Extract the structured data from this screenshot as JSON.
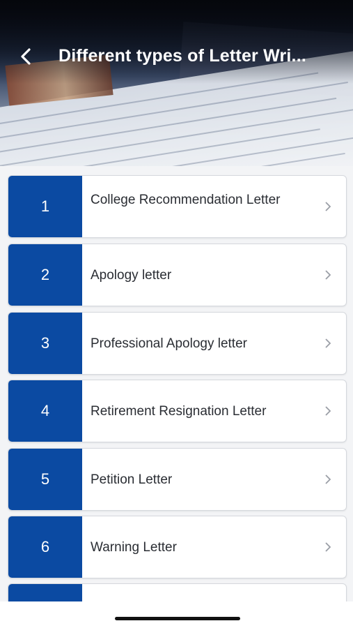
{
  "header": {
    "title": "Different types of Letter Wri...",
    "back_icon": "chevron-left-icon"
  },
  "items": [
    {
      "number": "1",
      "label": "College Recommendation Letter"
    },
    {
      "number": "2",
      "label": "Apology letter"
    },
    {
      "number": "3",
      "label": "Professional Apology letter"
    },
    {
      "number": "4",
      "label": "Retirement Resignation Letter"
    },
    {
      "number": "5",
      "label": "Petition Letter"
    },
    {
      "number": "6",
      "label": "Warning Letter"
    },
    {
      "number": "",
      "label": ""
    }
  ],
  "colors": {
    "accent": "#0b4aa2",
    "text": "#2a2d33",
    "chevron": "#9a9ea6"
  }
}
